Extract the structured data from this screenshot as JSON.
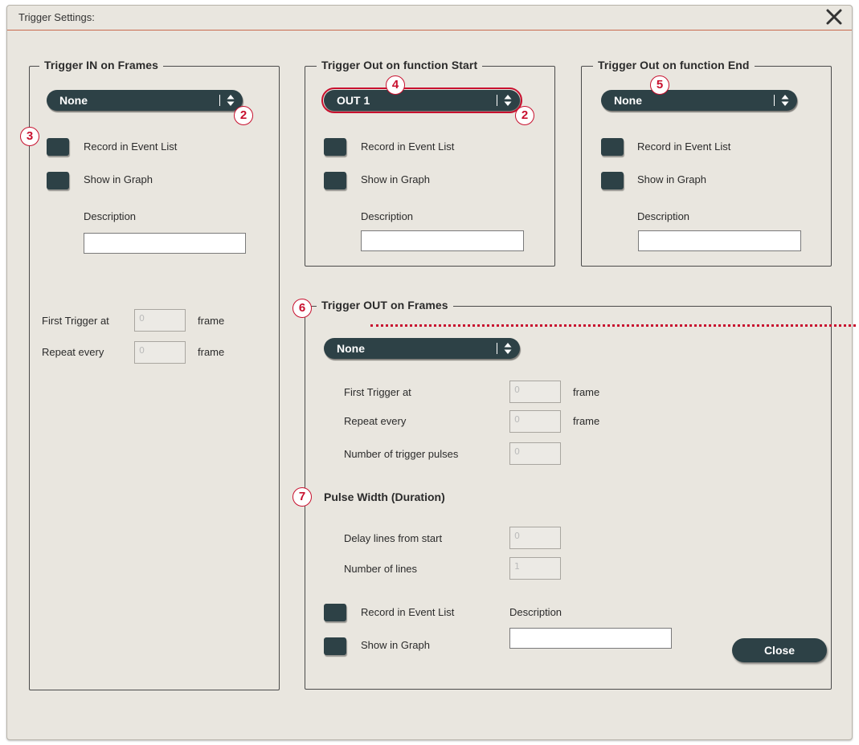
{
  "window": {
    "title": "Trigger Settings:"
  },
  "trigger_in": {
    "legend": "Trigger IN on Frames",
    "dropdown_value": "None",
    "record_label": "Record in Event List",
    "graph_label": "Show in Graph",
    "description_label": "Description",
    "first_trigger_label": "First Trigger at",
    "first_trigger_value": "0",
    "first_trigger_unit": "frame",
    "repeat_label": "Repeat every",
    "repeat_value": "0",
    "repeat_unit": "frame"
  },
  "trigger_out_start": {
    "legend": "Trigger Out on function Start",
    "dropdown_value": "OUT 1",
    "record_label": "Record in Event List",
    "graph_label": "Show in Graph",
    "description_label": "Description"
  },
  "trigger_out_end": {
    "legend": "Trigger Out on function End",
    "dropdown_value": "None",
    "record_label": "Record in Event List",
    "graph_label": "Show in Graph",
    "description_label": "Description"
  },
  "trigger_out_frames": {
    "legend": "Trigger OUT on Frames",
    "dropdown_value": "None",
    "first_trigger_label": "First Trigger at",
    "first_trigger_value": "0",
    "first_trigger_unit": "frame",
    "repeat_label": "Repeat every",
    "repeat_value": "0",
    "repeat_unit": "frame",
    "pulses_label": "Number of trigger pulses",
    "pulses_value": "0",
    "pulse_width_title": "Pulse Width (Duration)",
    "delay_label": "Delay lines from start",
    "delay_value": "0",
    "lines_label": "Number of lines",
    "lines_value": "1",
    "record_label": "Record in Event List",
    "graph_label": "Show in Graph",
    "description_label": "Description"
  },
  "buttons": {
    "close_label": "Close"
  },
  "callouts": {
    "b2": "2",
    "b3": "3",
    "b4": "4",
    "b5": "5",
    "b6": "6",
    "b7": "7"
  },
  "colors": {
    "control": "#2d4146",
    "accent": "#c8102e",
    "dialog_bg": "#e9e6df"
  },
  "icons": {
    "close": "close-x-icon",
    "dropdown": "up-down-arrows-icon"
  }
}
